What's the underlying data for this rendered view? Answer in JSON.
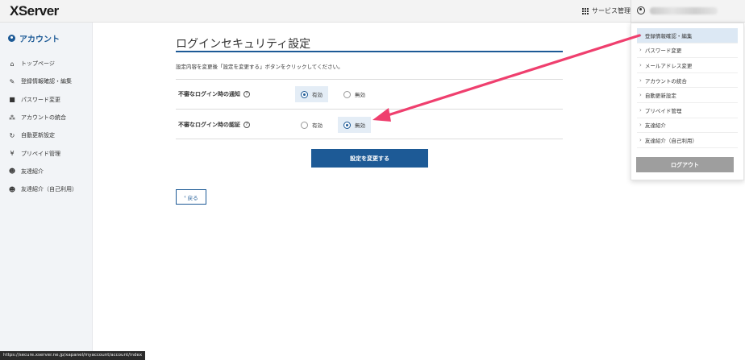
{
  "header": {
    "logo": "XServer",
    "services_label": "サービス管理"
  },
  "sidebar": {
    "title": "アカウント",
    "items": [
      {
        "label": "トップページ",
        "icon": "home-icon"
      },
      {
        "label": "登録情報確認・編集",
        "icon": "edit-icon"
      },
      {
        "label": "パスワード変更",
        "icon": "lock-icon"
      },
      {
        "label": "アカウントの統合",
        "icon": "merge-icon"
      },
      {
        "label": "自動更新設定",
        "icon": "refresh-icon"
      },
      {
        "label": "プリペイド管理",
        "icon": "yen-icon"
      },
      {
        "label": "友達紹介",
        "icon": "friend-icon"
      },
      {
        "label": "友達紹介（自己利用）",
        "icon": "friend-self-icon"
      }
    ]
  },
  "main": {
    "title": "ログインセキュリティ設定",
    "description": "設定内容を変更後「設定を変更する」ボタンをクリックしてください。",
    "settings": [
      {
        "label": "不審なログイン時の通知",
        "selected": "enabled",
        "options": [
          "有効",
          "無効"
        ]
      },
      {
        "label": "不審なログイン時の認証",
        "selected": "disabled",
        "options": [
          "有効",
          "無効"
        ]
      }
    ],
    "submit_label": "設定を変更する",
    "back_label": "戻る",
    "back_chevron": "‹"
  },
  "dropdown": {
    "items": [
      {
        "label": "登録情報確認・編集",
        "active": true
      },
      {
        "label": "パスワード変更",
        "active": false
      },
      {
        "label": "メールアドレス変更",
        "active": false
      },
      {
        "label": "アカウントの統合",
        "active": false
      },
      {
        "label": "自動更新設定",
        "active": false
      },
      {
        "label": "プリペイド管理",
        "active": false
      },
      {
        "label": "友達紹介",
        "active": false
      },
      {
        "label": "友達紹介（自己利用）",
        "active": false
      }
    ],
    "logout_label": "ログアウト"
  },
  "statusbar": {
    "url": "https://secure.xserver.ne.jp/xapanel/myaccount/account/index"
  },
  "colors": {
    "primary": "#1d5a96",
    "arrow": "#ef3f6e",
    "logout": "#9e9e9e"
  }
}
